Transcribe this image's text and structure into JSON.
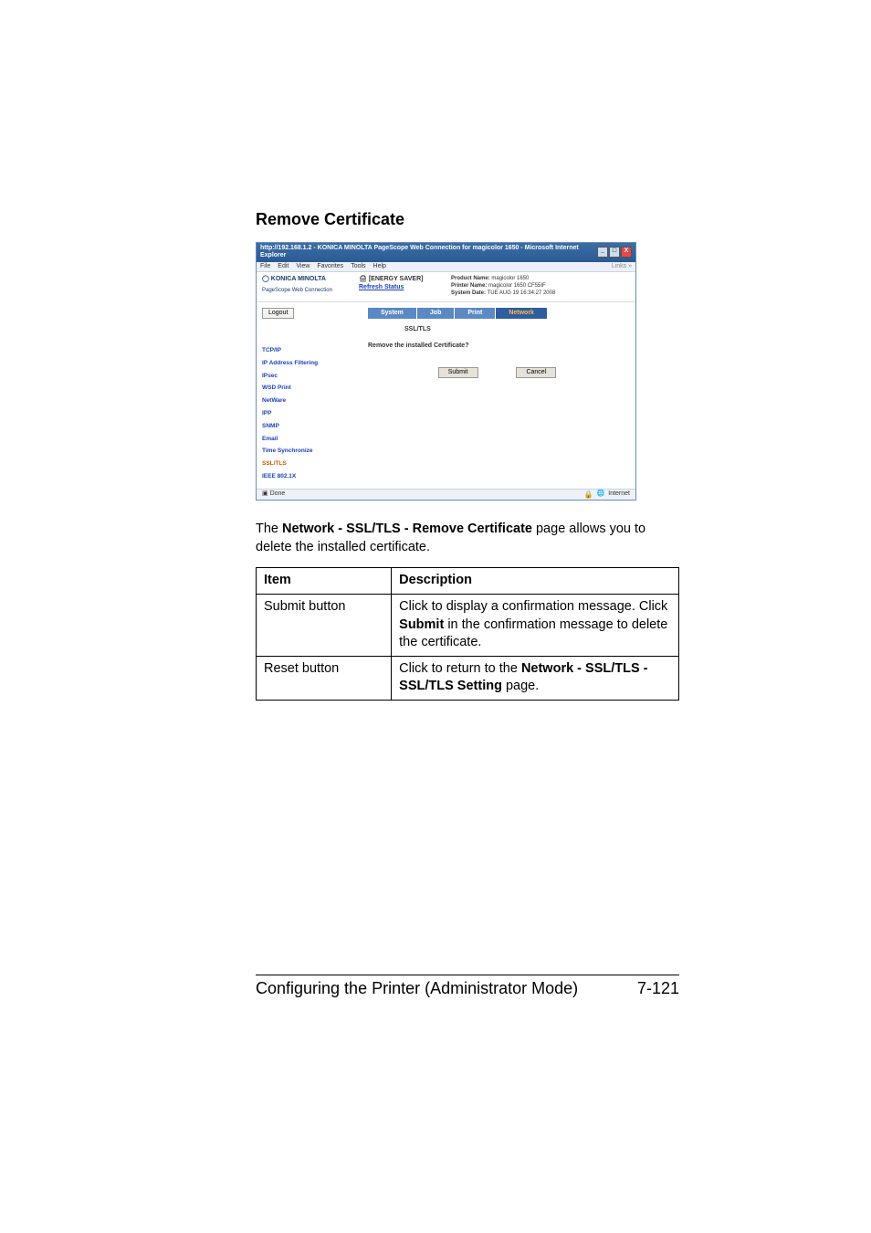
{
  "section_title": "Remove Certificate",
  "ie": {
    "title": "http://192.168.1.2 - KONICA MINOLTA PageScope Web Connection for magicolor 1650 - Microsoft Internet Explorer",
    "menu": {
      "file": "File",
      "edit": "Edit",
      "view": "View",
      "fav": "Favorites",
      "tools": "Tools",
      "help": "Help",
      "links": "Links »"
    },
    "brand": {
      "name": "KONICA MINOLTA",
      "sub": "PageScope Web Connection"
    },
    "status": {
      "energy": "[ENERGY SAVER]",
      "refresh": "Refresh Status"
    },
    "product": {
      "pn_label": "Product Name:",
      "pn_val": "magicolor 1650",
      "prn_label": "Printer Name:",
      "prn_val": "magicolor 1650 CF55IF",
      "sd_label": "System Date:",
      "sd_val": "TUE AUG 19 16:34:27 2008"
    },
    "logout": "Logout",
    "tabs": {
      "sys": "System",
      "job": "Job",
      "print": "Print",
      "net": "Network"
    },
    "sub_heading": "SSL/TLS",
    "question": "Remove the installed Certificate?",
    "submit": "Submit",
    "cancel": "Cancel",
    "side_items": [
      "TCP/IP",
      "IP Address Filtering",
      "IPsec",
      "WSD Print",
      "NetWare",
      "IPP",
      "SNMP",
      "Email",
      "Time Synchronize",
      "SSL/TLS",
      "IEEE 802.1X"
    ],
    "status_bar": {
      "done": "Done",
      "zone": "Internet"
    }
  },
  "description": {
    "pre": "The ",
    "bold": "Network - SSL/TLS - Remove Certificate",
    "post": " page allows you to delete the installed certificate."
  },
  "table": {
    "h1": "Item",
    "h2": "Description",
    "r1c1": "Submit button",
    "r1c2_a": "Click to display a confirmation message. Click ",
    "r1c2_b": "Submit",
    "r1c2_c": " in the confirmation message to delete the certificate.",
    "r2c1": "Reset button",
    "r2c2_a": "Click to return to the ",
    "r2c2_b": "Network - SSL/TLS - SSL/TLS Setting",
    "r2c2_c": " page."
  },
  "footer": {
    "left": "Configuring the Printer (Administrator Mode)",
    "right": "7-121"
  }
}
